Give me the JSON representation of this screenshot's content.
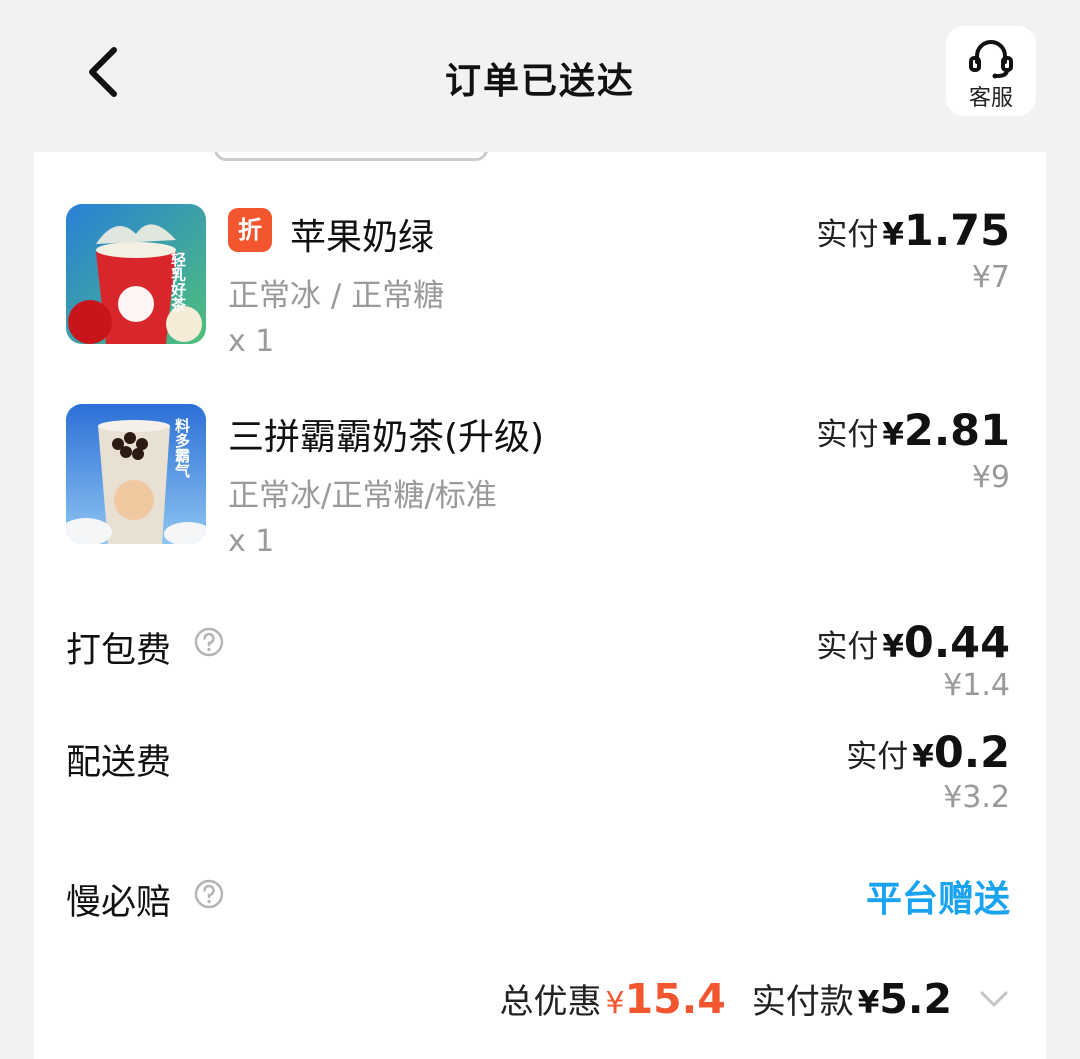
{
  "header": {
    "title": "订单已送达",
    "service_label": "客服"
  },
  "items": [
    {
      "badge": "折",
      "name": "苹果奶绿",
      "spec": "正常冰 / 正常糖",
      "qty": "x 1",
      "paid_label": "实付",
      "currency": "¥",
      "paid": "1.75",
      "original": "¥7",
      "thumb_text": "轻乳好茶"
    },
    {
      "name": "三拼霸霸奶茶(升级)",
      "spec": "正常冰/正常糖/标准",
      "qty": "x 1",
      "paid_label": "实付",
      "currency": "¥",
      "paid": "2.81",
      "original": "¥9",
      "thumb_text": "料多霸气"
    }
  ],
  "fees": {
    "packing": {
      "label": "打包费",
      "paid_label": "实付",
      "currency": "¥",
      "paid": "0.44",
      "original": "¥1.4"
    },
    "delivery": {
      "label": "配送费",
      "paid_label": "实付",
      "currency": "¥",
      "paid": "0.2",
      "original": "¥3.2"
    },
    "late_guarantee": {
      "label": "慢必赔",
      "value": "平台赠送"
    }
  },
  "summary": {
    "discount_label": "总优惠",
    "discount_currency": "¥",
    "discount": "15.4",
    "paid_label": "实付款",
    "paid_currency": "¥",
    "paid": "5.2"
  },
  "colors": {
    "accent_red": "#f2562f",
    "accent_blue": "#1aa3f0",
    "muted": "#9a9a9a"
  },
  "icons": {
    "back": "chevron-left-icon",
    "service": "headset-icon",
    "help": "question-circle-icon",
    "expand": "chevron-down-icon"
  }
}
